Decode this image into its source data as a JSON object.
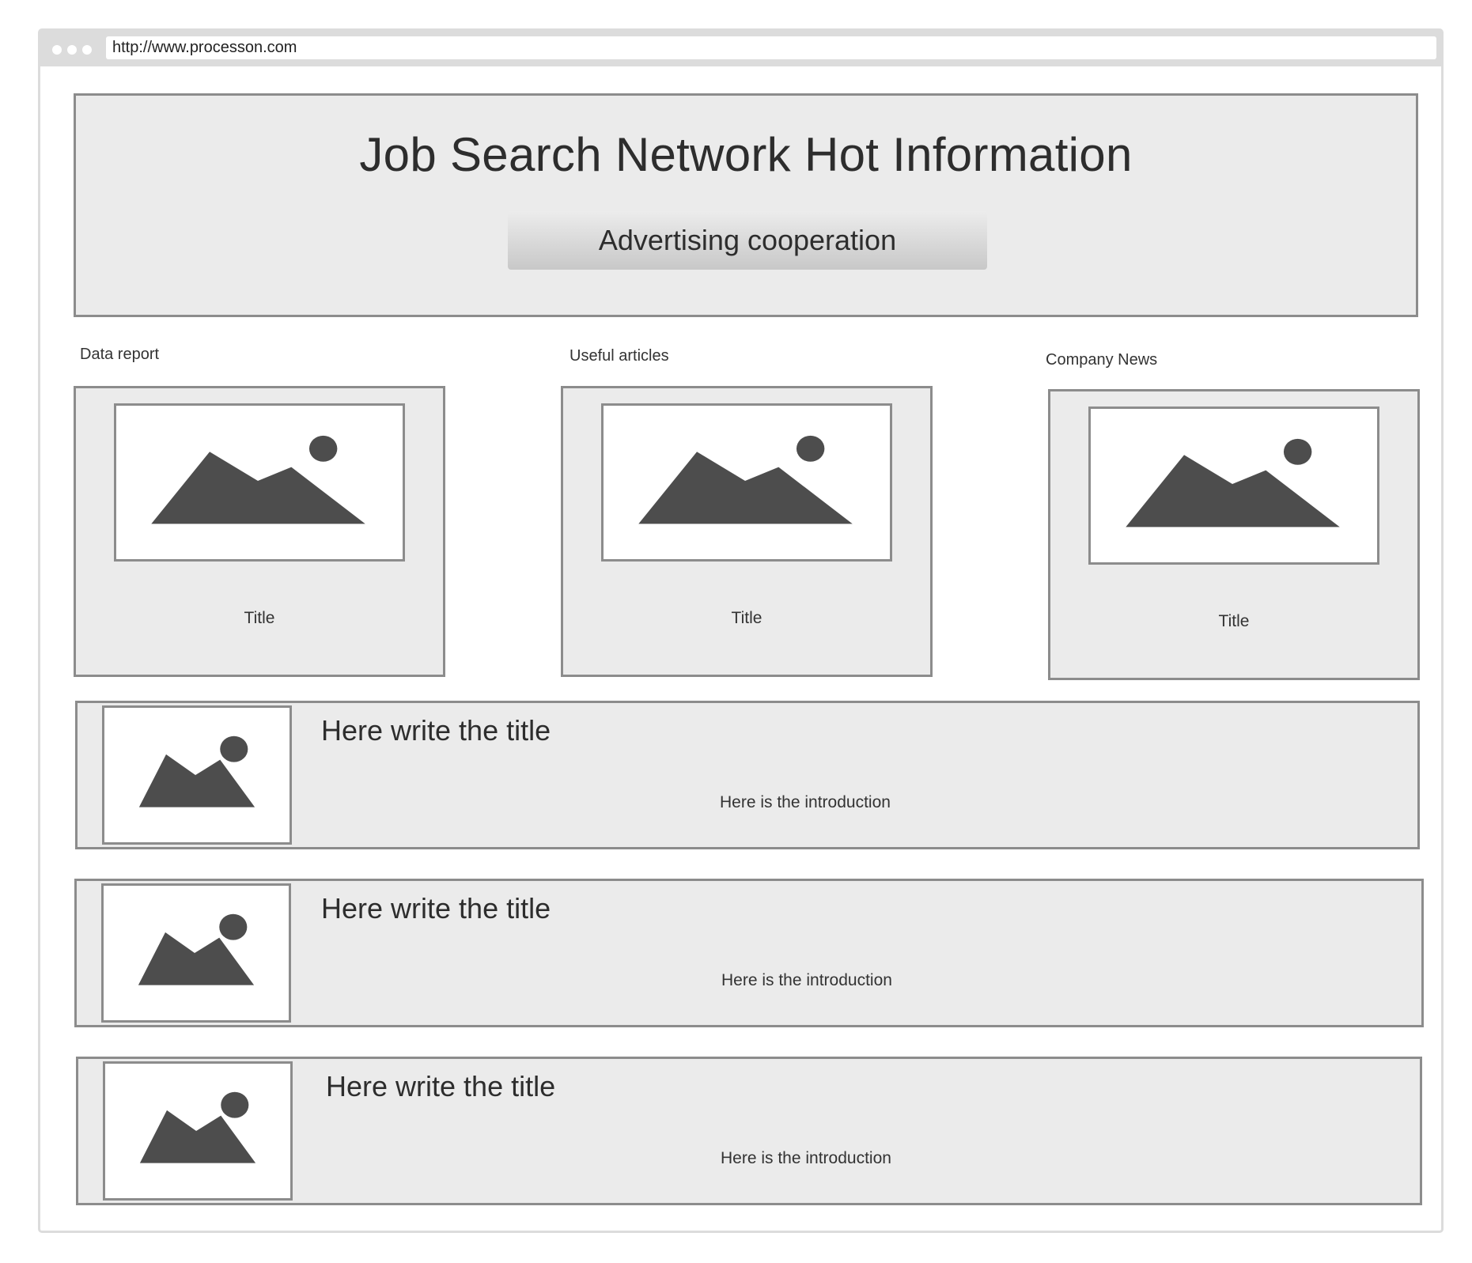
{
  "browser": {
    "url": "http://www.processon.com"
  },
  "header": {
    "title": "Job Search Network Hot Information",
    "button_label": "Advertising cooperation"
  },
  "sections": [
    {
      "label": "Data report",
      "card_title": "Title"
    },
    {
      "label": "Useful articles",
      "card_title": "Title"
    },
    {
      "label": "Company News",
      "card_title": "Title"
    }
  ],
  "articles": [
    {
      "title": "Here write the title",
      "intro": "Here is the introduction"
    },
    {
      "title": "Here write the title",
      "intro": "Here is the introduction"
    },
    {
      "title": "Here write the title",
      "intro": "Here is the introduction"
    }
  ],
  "colors": {
    "panel_fill": "#ebebeb",
    "panel_border": "#8c8c8c",
    "image_glyph": "#4d4d4d"
  },
  "icons": {
    "image_placeholder": "image-placeholder-icon"
  }
}
